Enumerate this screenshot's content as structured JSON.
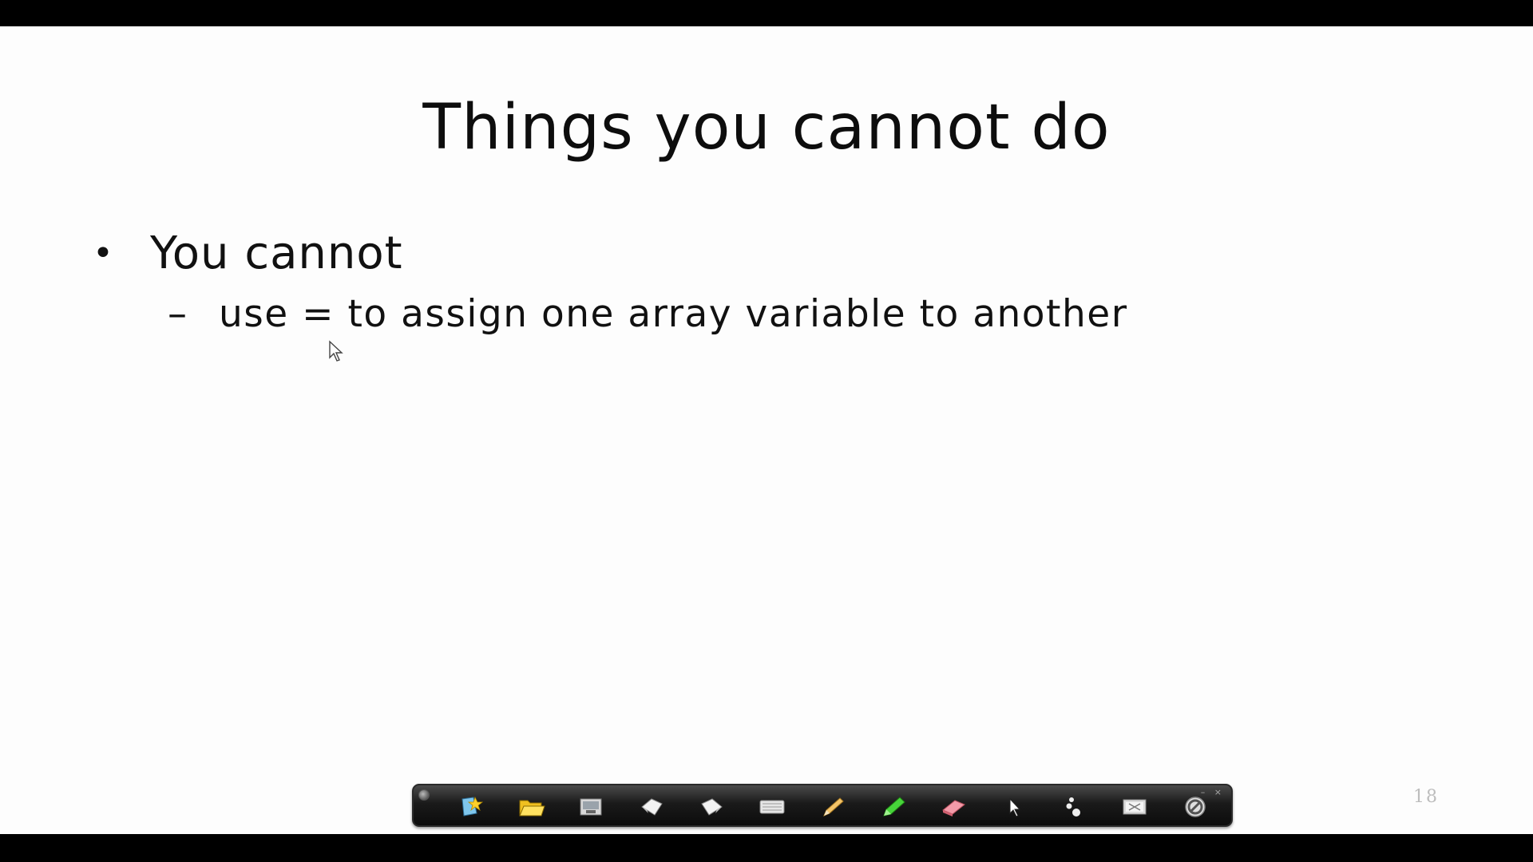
{
  "slide": {
    "title": "Things you cannot do",
    "bullet": "You cannot",
    "sub_dash": "–",
    "sub_bullet": "use = to assign one array variable to another",
    "page_number": "18"
  },
  "toolbar": {
    "tools": [
      "new-page-icon",
      "open-folder-icon",
      "screen-capture-icon",
      "previous-page-icon",
      "next-page-icon",
      "keyboard-icon",
      "pen-icon",
      "highlighter-icon",
      "eraser-icon",
      "pointer-icon",
      "more-icon",
      "clear-screen-icon",
      "stop-icon"
    ],
    "minmax": "– ×"
  }
}
